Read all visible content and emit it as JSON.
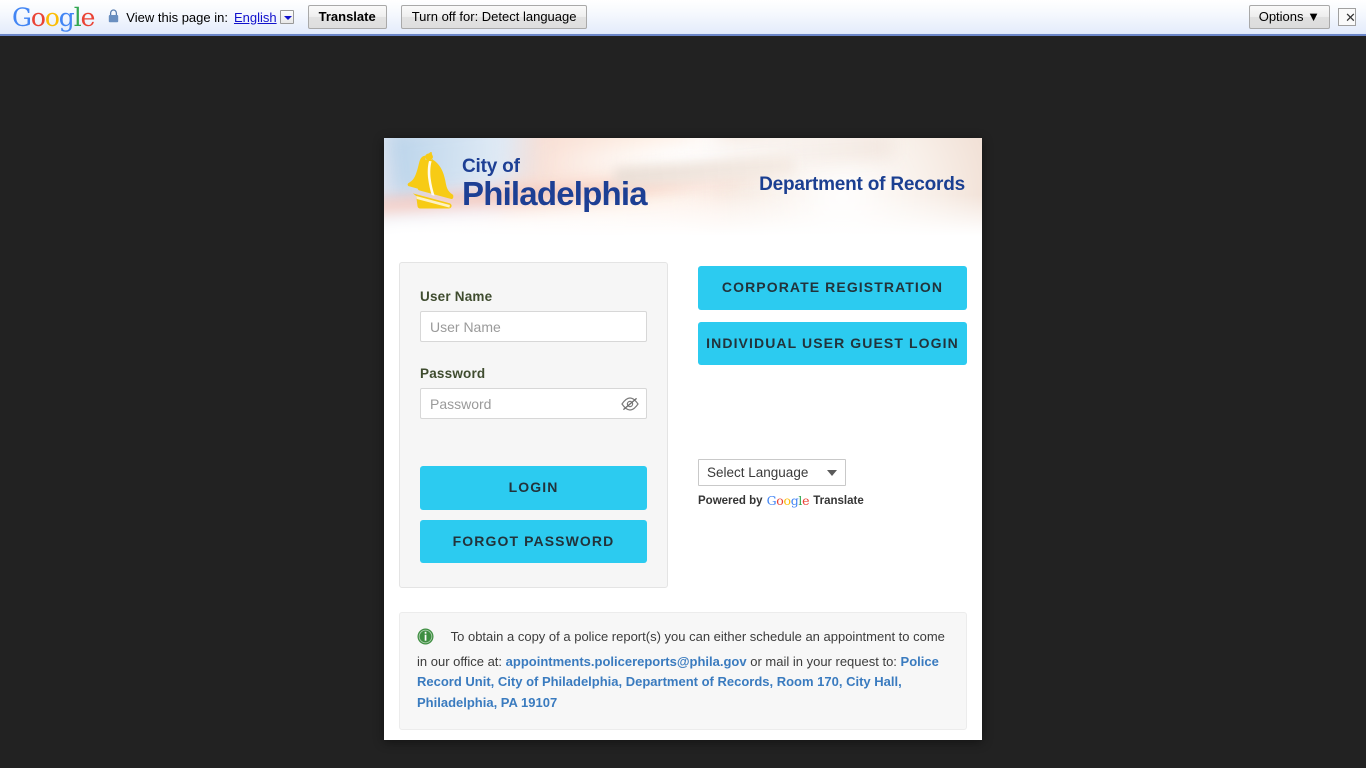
{
  "translate_bar": {
    "google_logo": "Google",
    "lock_icon": "lock-icon",
    "view_text": "View this page in:",
    "language_link": "English",
    "translate_button": "Translate",
    "turn_off_button": "Turn off for: Detect language",
    "options_button": "Options ▼",
    "close_button": "✕"
  },
  "header": {
    "logo_icon": "liberty-bell-icon",
    "city_line1": "City of",
    "city_line2": "Philadelphia",
    "department_title": "Department of Records"
  },
  "login_form": {
    "username_label": "User Name",
    "username_placeholder": "User Name",
    "username_value": "",
    "password_label": "Password",
    "password_placeholder": "Password",
    "password_value": "",
    "toggle_password_icon": "eye-slash-icon",
    "login_button": "LOGIN",
    "forgot_password_button": "FORGOT PASSWORD"
  },
  "actions": {
    "corporate_registration": "CORPORATE REGISTRATION",
    "individual_guest_login": "INDIVIDUAL USER GUEST LOGIN"
  },
  "translate_widget": {
    "select_value": "Select Language",
    "powered_by": "Powered by",
    "google_word": "Google",
    "translate_word": "Translate"
  },
  "notice": {
    "info_icon": "info-circle-icon",
    "text_part1": "To obtain a copy of a police report(s) you can either schedule an appointment to come in our office at:",
    "email": "appointments.policereports@phila.gov",
    "text_part2": "or mail in your request to:",
    "address": "Police Record Unit, City of Philadelphia, Department of Records, Room 170, City Hall, Philadelphia, PA 19107"
  },
  "colors": {
    "accent_cyan": "#2CCBF0",
    "brand_navy": "#1D3F94",
    "bell_gold": "#F7CB15",
    "label_olive": "#3F4C2F",
    "link_blue": "#3A7BBF",
    "page_background": "#222222",
    "info_green": "#3E8E41"
  }
}
